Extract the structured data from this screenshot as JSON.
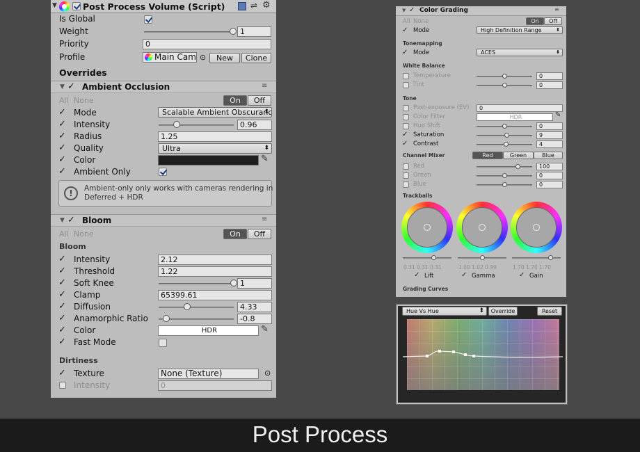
{
  "component": {
    "title": "Post Process Volume (Script)",
    "is_global_label": "Is Global",
    "weight_label": "Weight",
    "weight_value": "1",
    "weight_fraction": 1.0,
    "priority_label": "Priority",
    "priority_value": "0",
    "profile_label": "Profile",
    "profile_value": "Main Cam",
    "new_label": "New",
    "clone_label": "Clone",
    "overrides_label": "Overrides"
  },
  "ambient_occlusion": {
    "title": "Ambient Occlusion",
    "all": "All",
    "none": "None",
    "on": "On",
    "off": "Off",
    "mode_label": "Mode",
    "mode_value": "Scalable Ambient Obscuranc",
    "intensity_label": "Intensity",
    "intensity_value": "0.96",
    "intensity_fraction": 0.24,
    "radius_label": "Radius",
    "radius_value": "1.25",
    "quality_label": "Quality",
    "quality_value": "Ultra",
    "color_label": "Color",
    "color_value": "#1e1e1e",
    "ambient_only_label": "Ambient Only",
    "help_text_1": "Ambient-only only works with cameras rendering in",
    "help_text_2": "Deferred + HDR"
  },
  "bloom": {
    "title": "Bloom",
    "all": "All",
    "none": "None",
    "on": "On",
    "off": "Off",
    "section_label": "Bloom",
    "intensity_label": "Intensity",
    "intensity_value": "2.12",
    "threshold_label": "Threshold",
    "threshold_value": "1.22",
    "soft_knee_label": "Soft Knee",
    "soft_knee_value": "1",
    "soft_knee_fraction": 1.0,
    "clamp_label": "Clamp",
    "clamp_value": "65399.61",
    "diffusion_label": "Diffusion",
    "diffusion_value": "4.33",
    "diffusion_fraction": 0.38,
    "anamorphic_label": "Anamorphic Ratio",
    "anamorphic_value": "-0.8",
    "anamorphic_fraction": 0.1,
    "color_label": "Color",
    "color_value": "HDR",
    "fast_mode_label": "Fast Mode",
    "dirtiness_label": "Dirtiness",
    "texture_label": "Texture",
    "texture_value": "None (Texture)",
    "dirt_intensity_label": "Intensity",
    "dirt_intensity_value": "0"
  },
  "color_grading": {
    "title": "Color Grading",
    "all": "All",
    "none": "None",
    "on": "On",
    "off": "Off",
    "mode_label": "Mode",
    "mode_value": "High Definition Range",
    "tonemapping_label": "Tonemapping",
    "tm_mode_label": "Mode",
    "tm_mode_value": "ACES",
    "white_balance_label": "White Balance",
    "temperature_label": "Temperature",
    "temperature_value": "0",
    "tint_label": "Tint",
    "tint_value": "0",
    "tone_label": "Tone",
    "post_exposure_label": "Post-exposure (EV)",
    "post_exposure_value": "0",
    "color_filter_label": "Color Filter",
    "color_filter_value": "HDR",
    "hue_shift_label": "Hue Shift",
    "hue_shift_value": "0",
    "saturation_label": "Saturation",
    "saturation_value": "9",
    "contrast_label": "Contrast",
    "contrast_value": "4",
    "channel_mixer_label": "Channel Mixer",
    "tab_red": "Red",
    "tab_green": "Green",
    "tab_blue": "Blue",
    "mixer_red_label": "Red",
    "mixer_red_value": "100",
    "mixer_green_label": "Green",
    "mixer_green_value": "0",
    "mixer_blue_label": "Blue",
    "mixer_blue_value": "0",
    "trackballs_label": "Trackballs",
    "lift_values": "0.31  0.31  0.31",
    "gamma_values": "1.00  1.02  0.99",
    "gain_values": "1.70  1.70  1.70",
    "lift_label": "Lift",
    "gamma_label": "Gamma",
    "gain_label": "Gain",
    "grading_curves_label": "Grading Curves"
  },
  "curves": {
    "curve_select": "Hue Vs Hue",
    "override_label": "Override",
    "reset_label": "Reset"
  },
  "footer_title": "Post Process"
}
